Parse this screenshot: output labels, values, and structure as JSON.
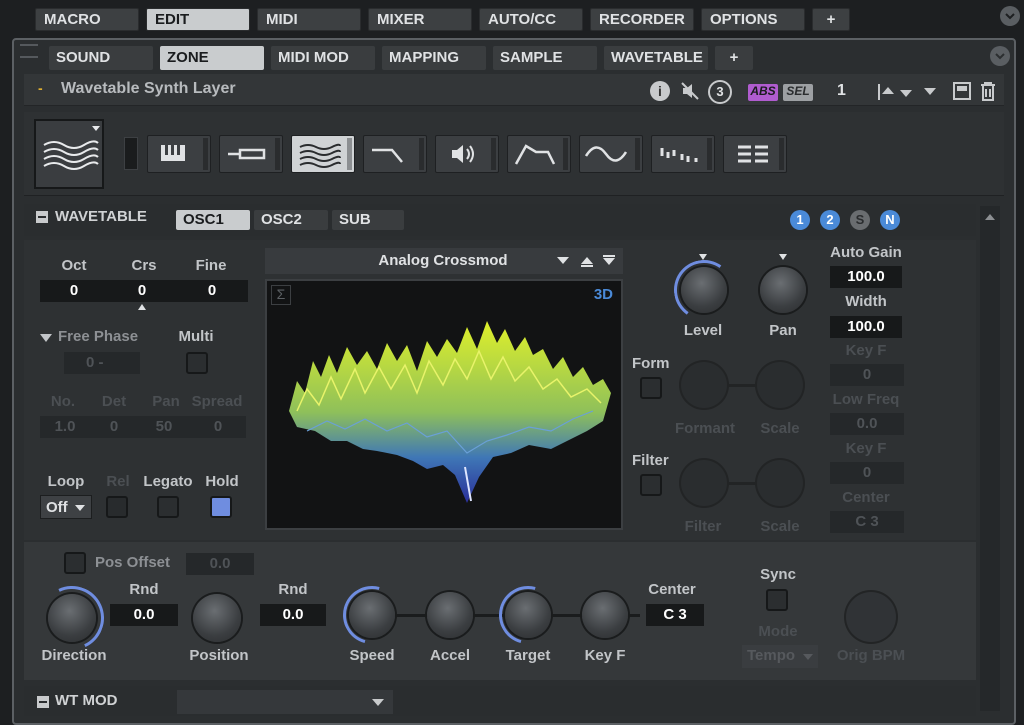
{
  "top_tabs": [
    "MACRO",
    "EDIT",
    "MIDI",
    "MIXER",
    "AUTO/CC",
    "RECORDER",
    "OPTIONS",
    "+"
  ],
  "sub_tabs": [
    "SOUND",
    "ZONE",
    "MIDI MOD",
    "MAPPING",
    "SAMPLE",
    "WAVETABLE",
    "+"
  ],
  "layer": {
    "title": "Wavetable Synth Layer",
    "abs": "ABS",
    "sel": "SEL",
    "num": "1",
    "tool_num": "3",
    "dash": "-"
  },
  "wt": {
    "header": "WAVETABLE",
    "tabs": [
      "OSC1",
      "OSC2",
      "SUB"
    ],
    "badges": [
      "1",
      "2",
      "S",
      "N"
    ],
    "octave": {
      "oct_label": "Oct",
      "crs_label": "Crs",
      "fine_label": "Fine",
      "oct": "0",
      "crs": "0",
      "fine": "0"
    },
    "free_phase": "Free Phase",
    "multi": "Multi",
    "phase_val": "0 -",
    "no": "No.",
    "det": "Det",
    "pan": "Pan",
    "spread": "Spread",
    "no_v": "1.0",
    "det_v": "0",
    "pan_v": "50",
    "spread_v": "0",
    "loop": "Loop",
    "loop_v": "Off",
    "rel": "Rel",
    "legato": "Legato",
    "hold": "Hold",
    "preset": "Analog Crossmod",
    "display_3d": "3D",
    "sigma": "Σ",
    "level": "Level",
    "pan_knob": "Pan",
    "auto_gain": "Auto Gain",
    "auto_gain_v": "100.0",
    "width": "Width",
    "width_v": "100.0",
    "form": "Form",
    "formant": "Formant",
    "scale": "Scale",
    "key_f": "Key F",
    "key_f_v": "0",
    "low_freq": "Low Freq",
    "low_freq_v": "0.0",
    "filter": "Filter",
    "filter_knob": "Filter",
    "scale2": "Scale",
    "key_f2": "Key F",
    "key_f2_v": "0",
    "center": "Center",
    "center_v": "C  3"
  },
  "pos": {
    "pos_offset": "Pos Offset",
    "pos_offset_v": "0.0",
    "rnd": "Rnd",
    "rnd_v": "0.0",
    "rnd2": "Rnd",
    "rnd2_v": "0.0",
    "direction": "Direction",
    "position": "Position",
    "speed": "Speed",
    "accel": "Accel",
    "target": "Target",
    "key_f": "Key F",
    "center": "Center",
    "center_v": "C  3",
    "sync": "Sync",
    "mode": "Mode",
    "mode_v": "Tempo",
    "orig_bpm": "Orig BPM"
  },
  "wtmod": {
    "header": "WT MOD"
  },
  "colors": {
    "accent": "#6f8de0",
    "check_on": "#6f8de0",
    "badge": "#4a8ad8",
    "abs": "#b05ccf"
  }
}
